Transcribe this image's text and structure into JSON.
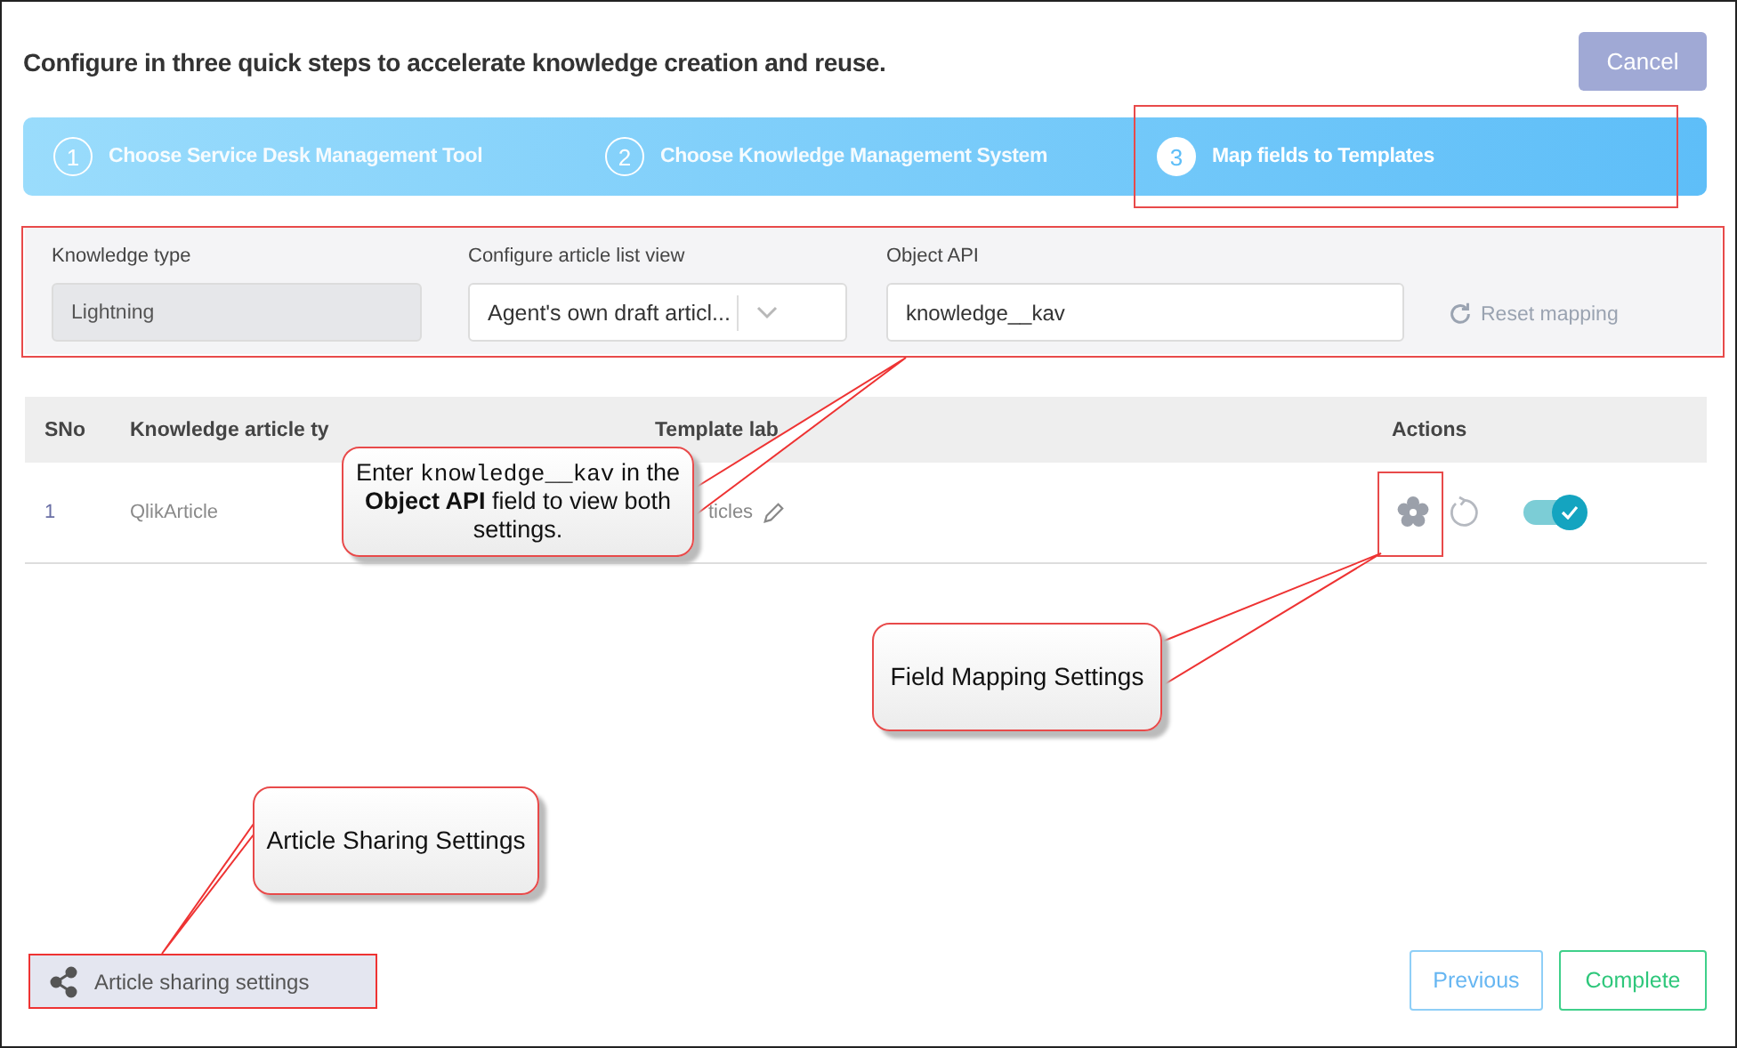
{
  "heading": "Configure in three quick steps to accelerate knowledge creation and reuse.",
  "cancel_button": "Cancel",
  "steps": [
    {
      "number": "1",
      "label": "Choose Service Desk Management Tool",
      "selected": false
    },
    {
      "number": "2",
      "label": "Choose Knowledge Management System",
      "selected": false
    },
    {
      "number": "3",
      "label": "Map fields to Templates",
      "selected": true
    }
  ],
  "filters": {
    "knowledge_type": {
      "label": "Knowledge type",
      "value": "Lightning",
      "disabled": true
    },
    "list_view": {
      "label": "Configure article list view",
      "value": "Agent's own draft articl..."
    },
    "object_api": {
      "label": "Object API",
      "value": "knowledge__kav"
    },
    "reset_button": "Reset mapping"
  },
  "table": {
    "columns": [
      "SNo",
      "Knowledge article ty",
      "Template lab"
    ],
    "actions_header": "Actions",
    "rows": [
      {
        "sno": "1",
        "article_type": "QlikArticle",
        "template": "ticles",
        "enabled": true
      }
    ]
  },
  "callouts": [
    {
      "kind": "object-api",
      "segments": [
        {
          "kind": "plain",
          "text": "Enter "
        },
        {
          "kind": "code",
          "text": "knowledge__kav"
        },
        {
          "kind": "plain",
          "text": " in the **Object API** field to view both settings."
        }
      ]
    },
    {
      "kind": "field-mapping",
      "text": "Field Mapping Settings"
    },
    {
      "kind": "sharing",
      "text": "Article Sharing Settings"
    }
  ],
  "sharing_button": "Article sharing settings",
  "previous_button": "Previous",
  "complete_button": "Complete"
}
